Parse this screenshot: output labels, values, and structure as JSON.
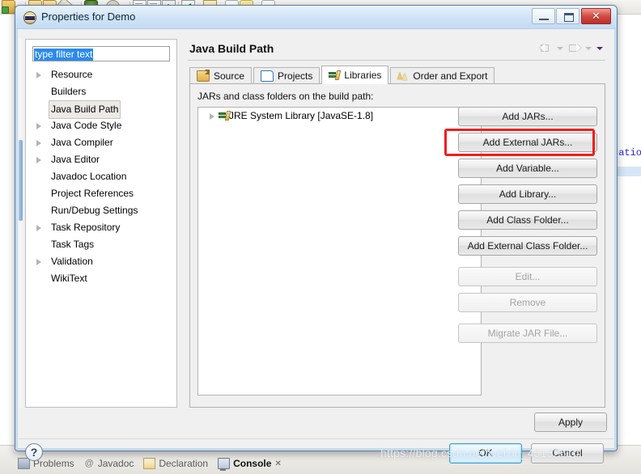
{
  "window": {
    "title": "Properties for Demo",
    "title_icon": "eclipse-globe-icon",
    "minimize_label": "",
    "maximize_label": "",
    "close_label": "✕"
  },
  "sidebar": {
    "filter": {
      "value": "type filter text",
      "placeholder": "type filter text"
    },
    "items": [
      {
        "label": "Resource",
        "expandable": true,
        "selected": false
      },
      {
        "label": "Builders",
        "expandable": false,
        "selected": false
      },
      {
        "label": "Java Build Path",
        "expandable": false,
        "selected": true
      },
      {
        "label": "Java Code Style",
        "expandable": true,
        "selected": false
      },
      {
        "label": "Java Compiler",
        "expandable": true,
        "selected": false
      },
      {
        "label": "Java Editor",
        "expandable": true,
        "selected": false
      },
      {
        "label": "Javadoc Location",
        "expandable": false,
        "selected": false
      },
      {
        "label": "Project References",
        "expandable": false,
        "selected": false
      },
      {
        "label": "Run/Debug Settings",
        "expandable": false,
        "selected": false
      },
      {
        "label": "Task Repository",
        "expandable": true,
        "selected": false
      },
      {
        "label": "Task Tags",
        "expandable": false,
        "selected": false
      },
      {
        "label": "Validation",
        "expandable": true,
        "selected": false
      },
      {
        "label": "WikiText",
        "expandable": false,
        "selected": false
      }
    ]
  },
  "page": {
    "title": "Java Build Path",
    "nav": {
      "back_icon": "back-arrow-icon",
      "back_caret_icon": "chevron-down-icon",
      "forward_icon": "forward-arrow-icon",
      "forward_caret_icon": "chevron-down-icon",
      "menu_caret_icon": "chevron-down-filled-icon"
    },
    "tabs": [
      {
        "label": "Source",
        "icon": "source-folder-icon",
        "active": false
      },
      {
        "label": "Projects",
        "icon": "open-folder-icon",
        "active": false
      },
      {
        "label": "Libraries",
        "icon": "library-books-icon",
        "active": true
      },
      {
        "label": "Order and Export",
        "icon": "order-arrows-icon",
        "active": false
      }
    ],
    "panel_label": "JARs and class folders on the build path:",
    "entries": [
      {
        "label": "JRE System Library [JavaSE-1.8]",
        "icon": "library-books-icon",
        "expandable": true
      }
    ],
    "buttons": [
      {
        "label": "Add JARs...",
        "enabled": true,
        "highlighted": false
      },
      {
        "label": "Add External JARs...",
        "enabled": true,
        "highlighted": true
      },
      {
        "label": "Add Variable...",
        "enabled": true,
        "highlighted": false
      },
      {
        "label": "Add Library...",
        "enabled": true,
        "highlighted": false
      },
      {
        "label": "Add Class Folder...",
        "enabled": true,
        "highlighted": false
      },
      {
        "label": "Add External Class Folder...",
        "enabled": true,
        "highlighted": false
      },
      {
        "label": "Edit...",
        "enabled": false,
        "highlighted": false
      },
      {
        "label": "Remove",
        "enabled": false,
        "highlighted": false
      },
      {
        "label": "Migrate JAR File...",
        "enabled": false,
        "highlighted": false
      }
    ],
    "apply_label": "Apply"
  },
  "footer": {
    "help_label": "?",
    "ok_label": "OK",
    "cancel_label": "Cancel"
  },
  "background": {
    "code_fragment": "cation",
    "view_tabs": [
      {
        "label": "Problems",
        "icon": "problems-icon",
        "active": false
      },
      {
        "label": "Javadoc",
        "icon": "javadoc-at-icon",
        "active": false
      },
      {
        "label": "Declaration",
        "icon": "declaration-icon",
        "active": false
      },
      {
        "label": "Console",
        "icon": "console-icon",
        "active": true
      }
    ],
    "console_close_glyph": "✕"
  },
  "watermark": "https://blog.csdn.net/weixin_45152610",
  "colors": {
    "highlight": "#f21d1d",
    "selection": "#2a8aef",
    "title_gradient_top": "#e8f2fb",
    "ok_accent": "#2f9fd8"
  }
}
